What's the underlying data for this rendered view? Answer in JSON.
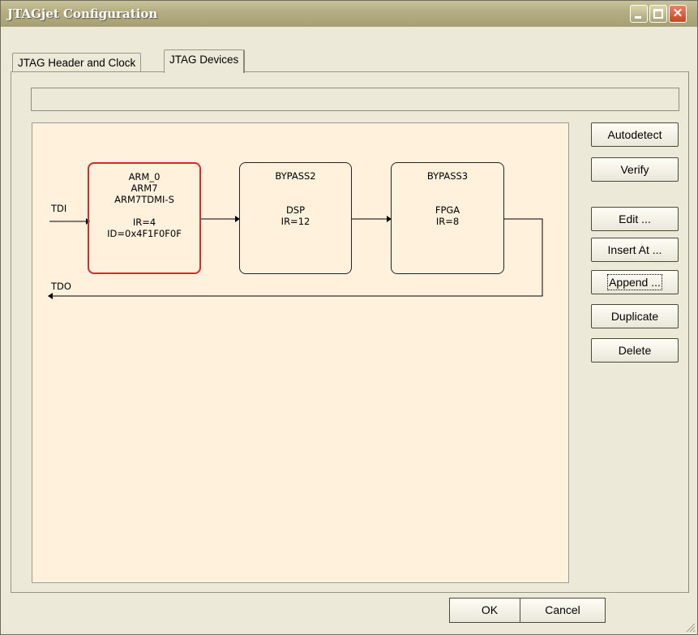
{
  "window": {
    "title": "JTAGjet Configuration"
  },
  "tabs": [
    {
      "label": "JTAG Header and Clock",
      "selected": false
    },
    {
      "label": "JTAG Devices",
      "selected": true
    }
  ],
  "status_text": "",
  "chain": {
    "tdi_label": "TDI",
    "tdo_label": "TDO",
    "devices": [
      {
        "name": "ARM_0",
        "lines": [
          "ARM7",
          "ARM7TDMI-S",
          "",
          "IR=4",
          "ID=0x4F1F0F0F"
        ],
        "selected": true
      },
      {
        "name": "BYPASS2",
        "lines": [
          "",
          "",
          "DSP",
          "IR=12"
        ],
        "selected": false
      },
      {
        "name": "BYPASS3",
        "lines": [
          "",
          "",
          "FPGA",
          "IR=8"
        ],
        "selected": false
      }
    ]
  },
  "side_buttons": {
    "autodetect": "Autodetect",
    "verify": "Verify",
    "edit": "Edit ...",
    "insert_at": "Insert At ...",
    "append": "Append ...",
    "duplicate": "Duplicate",
    "delete": "Delete"
  },
  "footer": {
    "ok": "OK",
    "cancel": "Cancel"
  },
  "colors": {
    "canvas_bg": "#fff1db",
    "selected_border": "#d42a2a",
    "window_bg": "#ece9d8"
  }
}
